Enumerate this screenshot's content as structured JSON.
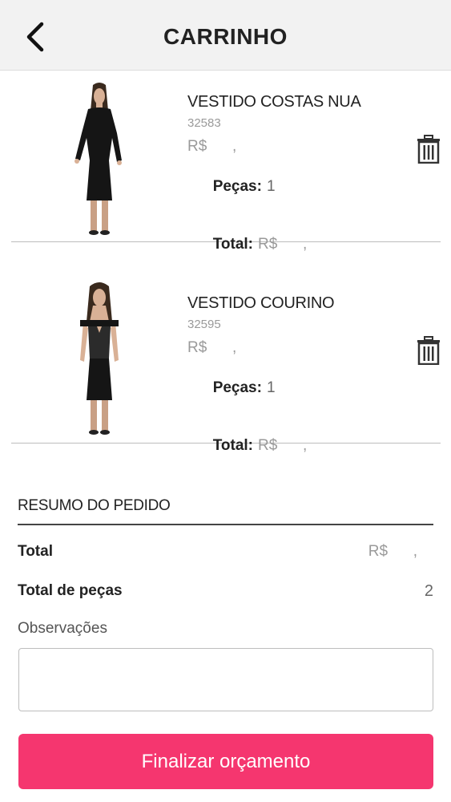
{
  "header": {
    "title": "CARRINHO",
    "back_icon": "chevron-left-icon"
  },
  "items": [
    {
      "name": "VESTIDO COSTAS NUA",
      "sku": "32583",
      "price": "R$      ,",
      "pieces_label": "Peças:",
      "pieces_value": "1",
      "total_label": "Total:",
      "total_value": "R$      ,",
      "delete_icon": "trash-icon",
      "dress_color": "#151515"
    },
    {
      "name": "VESTIDO COURINO",
      "sku": "32595",
      "price": "R$      ,",
      "pieces_label": "Peças:",
      "pieces_value": "1",
      "total_label": "Total:",
      "total_value": "R$      ,",
      "delete_icon": "trash-icon",
      "dress_color": "#151515"
    }
  ],
  "summary": {
    "title": "RESUMO DO PEDIDO",
    "total_label": "Total",
    "total_value": "R$      ,",
    "pieces_label": "Total de peças",
    "pieces_value": "2"
  },
  "observations": {
    "label": "Observações",
    "value": "",
    "placeholder": ""
  },
  "finalize_button": {
    "label": "Finalizar orçamento",
    "color": "#f5366f"
  }
}
